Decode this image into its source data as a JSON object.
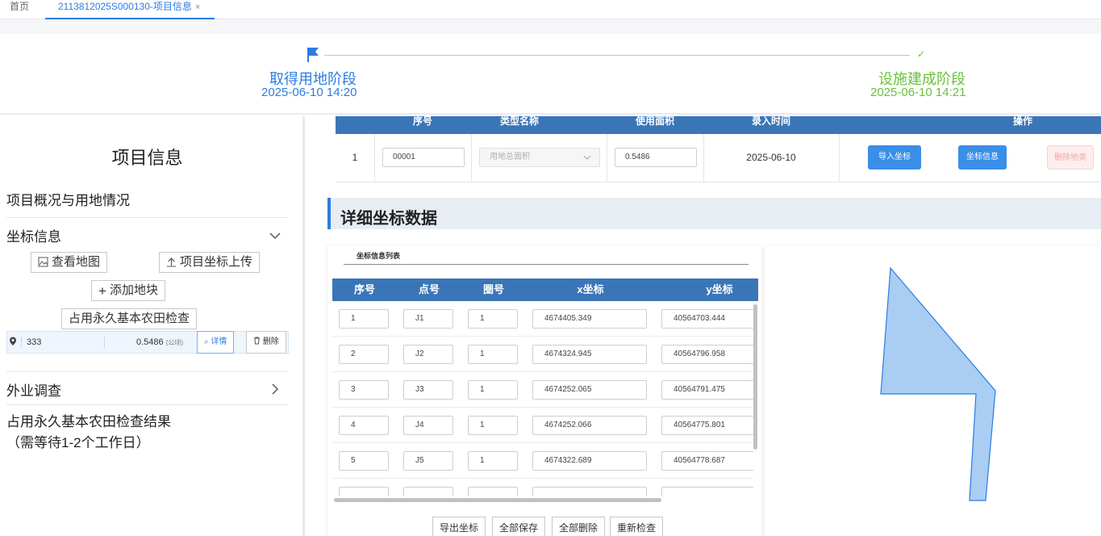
{
  "tabs": {
    "home": "首页",
    "active": "2113812025S000130-项目信息",
    "close": "×"
  },
  "stages": [
    {
      "name": "取得用地阶段",
      "time": "2025-06-10 14:20"
    },
    {
      "name": "设施建成阶段",
      "time": "2025-06-10 14:21"
    }
  ],
  "left": {
    "title": "项目信息",
    "section_overview": "项目概况与用地情况",
    "section_coords": "坐标信息",
    "btn_view_map": "查看地图",
    "btn_upload": "项目坐标上传",
    "btn_add_plot": "添加地块",
    "btn_farmland_check": "占用永久基本农田检查",
    "plot": {
      "name": "333",
      "area": "0.5486",
      "unit": "(公顷)",
      "detail": "详情",
      "delete": "删除"
    },
    "section_field": "外业调查",
    "result_line1": "占用永久基本农田检查结果",
    "result_line2": "（需等待1-2个工作日）"
  },
  "top_table": {
    "headers": [
      "序号",
      "类型名称",
      "使用面积",
      "录入时间",
      "操作"
    ],
    "row": {
      "index": "1",
      "code": "00001",
      "type_placeholder": "用地总面积",
      "area": "0.5486",
      "date": "2025-06-10",
      "btn_import": "导入坐标",
      "btn_info": "坐标信息",
      "btn_delete": "删除地类"
    }
  },
  "section_title": "详细坐标数据",
  "coord_card": {
    "title": "坐标信息列表",
    "headers": [
      "序号",
      "点号",
      "圈号",
      "x坐标",
      "y坐标"
    ],
    "rows": [
      [
        "1",
        "J1",
        "1",
        "4674405.349",
        "40564703.444"
      ],
      [
        "2",
        "J2",
        "1",
        "4674324.945",
        "40564796.958"
      ],
      [
        "3",
        "J3",
        "1",
        "4674252.065",
        "40564791.475"
      ],
      [
        "4",
        "J4",
        "1",
        "4674252.066",
        "40564775.801"
      ],
      [
        "5",
        "J5",
        "1",
        "4674322.689",
        "40564778.687"
      ],
      [
        "",
        "",
        "",
        "",
        ""
      ]
    ],
    "buttons": [
      "导出坐标",
      "全部保存",
      "全部删除",
      "重新检查"
    ]
  },
  "colors": {
    "accent": "#2a7de1",
    "success": "#67c23a",
    "table_header": "#3a76b7",
    "polygon_fill": "#a9cdf3"
  }
}
